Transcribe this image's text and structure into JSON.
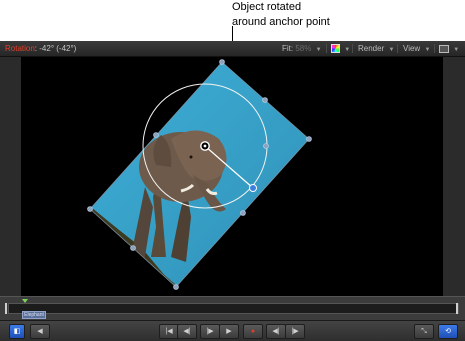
{
  "callout": {
    "line1": "Object rotated",
    "line2": "around anchor point"
  },
  "statusbar": {
    "param_name": "Rotation",
    "param_value": "-42° (-42°)"
  },
  "toolbar": {
    "fit_label": "Fit:",
    "fit_value": "58%",
    "render_label": "Render",
    "view_label": "View"
  },
  "timeline": {
    "clip_label": "Elephant"
  },
  "icons": {
    "color_channels": "rgb-channels-icon",
    "layout": "layout-icon",
    "record": "record-icon",
    "loop": "loop-icon"
  },
  "colors": {
    "param_accent": "#e0402a",
    "sky": "#3aa2c8",
    "loop_button": "#2a5fd0",
    "playhead": "#7fd15a"
  }
}
